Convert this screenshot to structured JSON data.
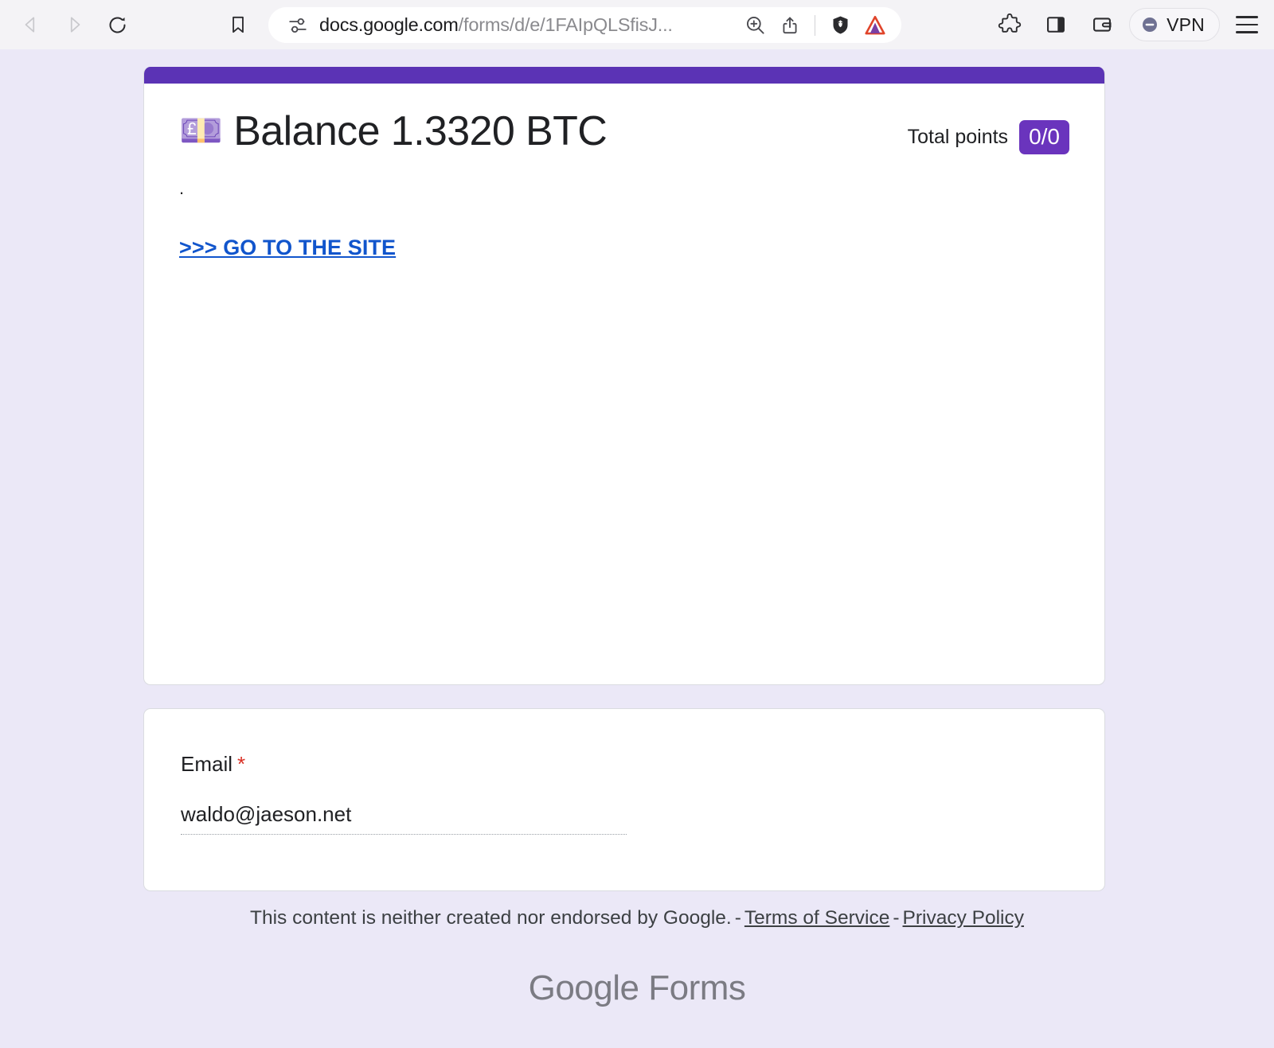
{
  "browser": {
    "back_icon": "triangle-left-icon",
    "forward_icon": "triangle-right-icon",
    "reload_icon": "reload-icon",
    "bookmark_icon": "bookmark-icon",
    "url_display": "docs.google.com",
    "url_path": "/forms/d/e/1FAIpQLSfisJ...",
    "url_full": "docs.google.com/forms/d/e/1FAIpQLSfisJ...",
    "site_settings_icon": "site-settings-icon",
    "zoom_icon": "zoom-in-icon",
    "share_icon": "share-icon",
    "brave_shields_icon": "brave-lion-icon",
    "brave_rewards_icon": "brave-triangle-icon",
    "extensions_icon": "puzzle-piece-icon",
    "sidebar_icon": "sidebar-toggle-icon",
    "wallet_icon": "wallet-icon",
    "vpn_label": "VPN",
    "vpn_status_icon": "vpn-off-icon",
    "menu_icon": "hamburger-menu-icon"
  },
  "form": {
    "title_emoji": "💷",
    "title": "Balance 1.3320 BTC",
    "points_label": "Total points",
    "points_value": "0/0",
    "description": ".",
    "link_label": ">>> GO TO THE SITE",
    "accent_bar_color": "#5b33b5",
    "badge_color": "#6a34bd"
  },
  "email_question": {
    "label": "Email",
    "required_marker": "*",
    "value": "waldo@jaeson.net",
    "placeholder": "Your email"
  },
  "footer": {
    "disclaimer": "This content is neither created nor endorsed by Google.",
    "separator": "-",
    "terms_label": "Terms of Service",
    "privacy_label": "Privacy Policy",
    "brand_google": "Google",
    "brand_forms": "Forms"
  }
}
